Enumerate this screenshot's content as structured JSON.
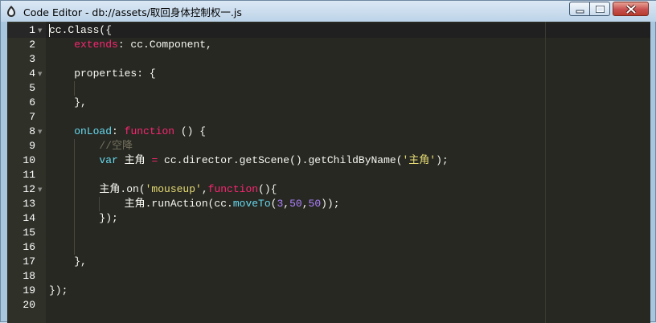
{
  "window": {
    "title": "Code Editor - db://assets/取回身体控制权一.js"
  },
  "theme": {
    "keyword": "#f92672",
    "storage": "#66d9ef",
    "function_name": "#66d9ef",
    "string": "#e6db74",
    "number": "#ae81ff",
    "comment": "#75715e",
    "text": "#f8f8f2",
    "background": "#272822"
  },
  "editor": {
    "lines": [
      {
        "number": "1",
        "fold": true,
        "tokens": [
          {
            "t": "cc.Class({",
            "c": "tx"
          }
        ]
      },
      {
        "number": "2",
        "fold": false,
        "tokens": [
          {
            "t": "    ",
            "c": "tx"
          },
          {
            "t": "extends",
            "c": "kw"
          },
          {
            "t": ": cc.Component,",
            "c": "tx"
          }
        ]
      },
      {
        "number": "3",
        "fold": false,
        "tokens": []
      },
      {
        "number": "4",
        "fold": true,
        "tokens": [
          {
            "t": "    properties: {",
            "c": "tx"
          }
        ]
      },
      {
        "number": "5",
        "fold": false,
        "tokens": []
      },
      {
        "number": "6",
        "fold": false,
        "tokens": [
          {
            "t": "    },",
            "c": "tx"
          }
        ]
      },
      {
        "number": "7",
        "fold": false,
        "tokens": []
      },
      {
        "number": "8",
        "fold": true,
        "tokens": [
          {
            "t": "    ",
            "c": "tx"
          },
          {
            "t": "onLoad",
            "c": "fn"
          },
          {
            "t": ": ",
            "c": "tx"
          },
          {
            "t": "function",
            "c": "kw"
          },
          {
            "t": " () {",
            "c": "tx"
          }
        ]
      },
      {
        "number": "9",
        "fold": false,
        "tokens": [
          {
            "t": "        ",
            "c": "tx"
          },
          {
            "t": "//空降",
            "c": "cm"
          }
        ]
      },
      {
        "number": "10",
        "fold": false,
        "tokens": [
          {
            "t": "        ",
            "c": "tx"
          },
          {
            "t": "var",
            "c": "st"
          },
          {
            "t": " 主角 ",
            "c": "tx"
          },
          {
            "t": "=",
            "c": "kw"
          },
          {
            "t": " cc.director.getScene().getChildByName(",
            "c": "tx"
          },
          {
            "t": "'主角'",
            "c": "str"
          },
          {
            "t": ");",
            "c": "tx"
          }
        ]
      },
      {
        "number": "11",
        "fold": false,
        "tokens": []
      },
      {
        "number": "12",
        "fold": true,
        "tokens": [
          {
            "t": "        主角.on(",
            "c": "tx"
          },
          {
            "t": "'mouseup'",
            "c": "str"
          },
          {
            "t": ",",
            "c": "tx"
          },
          {
            "t": "function",
            "c": "kw"
          },
          {
            "t": "(){",
            "c": "tx"
          }
        ]
      },
      {
        "number": "13",
        "fold": false,
        "tokens": [
          {
            "t": "            主角.runAction(cc.",
            "c": "tx"
          },
          {
            "t": "moveTo",
            "c": "fn"
          },
          {
            "t": "(",
            "c": "tx"
          },
          {
            "t": "3",
            "c": "num"
          },
          {
            "t": ",",
            "c": "tx"
          },
          {
            "t": "50",
            "c": "num"
          },
          {
            "t": ",",
            "c": "tx"
          },
          {
            "t": "50",
            "c": "num"
          },
          {
            "t": "));",
            "c": "tx"
          }
        ]
      },
      {
        "number": "14",
        "fold": false,
        "tokens": [
          {
            "t": "        });",
            "c": "tx"
          }
        ]
      },
      {
        "number": "15",
        "fold": false,
        "tokens": []
      },
      {
        "number": "16",
        "fold": false,
        "tokens": []
      },
      {
        "number": "17",
        "fold": false,
        "tokens": [
          {
            "t": "    },",
            "c": "tx"
          }
        ]
      },
      {
        "number": "18",
        "fold": false,
        "tokens": []
      },
      {
        "number": "19",
        "fold": false,
        "tokens": [
          {
            "t": "});",
            "c": "tx"
          }
        ]
      },
      {
        "number": "20",
        "fold": false,
        "tokens": []
      }
    ]
  }
}
